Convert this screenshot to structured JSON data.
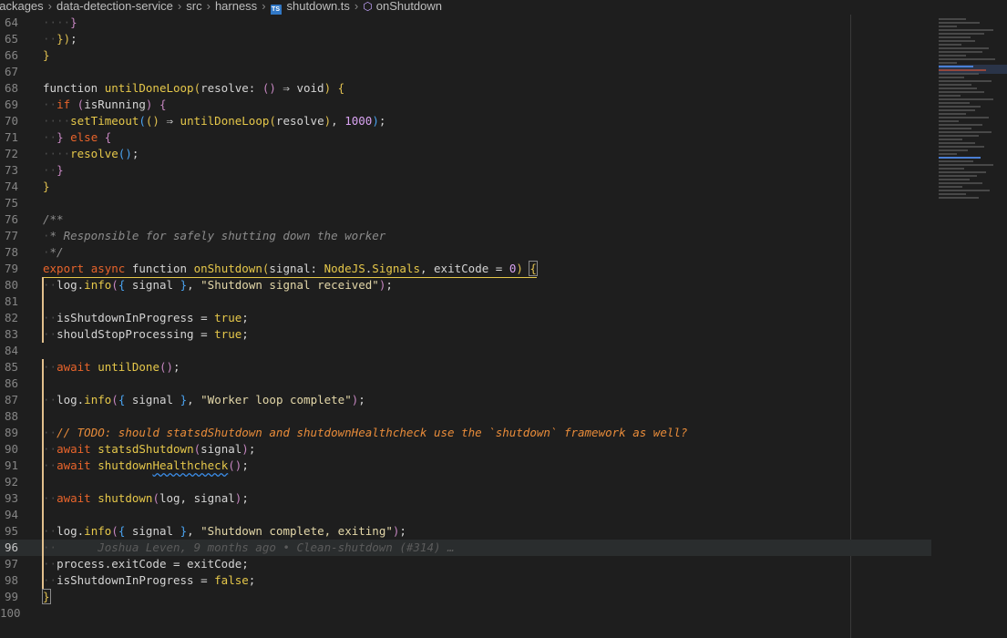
{
  "breadcrumb": {
    "segments": [
      "packages",
      "data-detection-service",
      "src",
      "harness",
      "shutdown.ts",
      "onShutdown"
    ],
    "file_icon": "TS"
  },
  "editor": {
    "line_numbers": [
      "64",
      "65",
      "66",
      "67",
      "68",
      "69",
      "70",
      "71",
      "72",
      "73",
      "74",
      "75",
      "76",
      "77",
      "78",
      "79",
      "80",
      "81",
      "82",
      "83",
      "84",
      "85",
      "86",
      "87",
      "88",
      "89",
      "90",
      "91",
      "92",
      "93",
      "94",
      "95",
      "96",
      "97",
      "98",
      "99",
      "100"
    ],
    "current_line": "96",
    "blame_text": "Joshua Leven, 9 months ago • Clean-shutdown (#314) …",
    "comment_responsible": "* Responsible for safely shutting down the worker",
    "comment_todo": "// TODO: should statsdShutdown and shutdownHealthcheck use the `shutdown` framework as well?",
    "str_signal_received": "\"Shutdown signal received\"",
    "str_worker_loop": "\"Worker loop complete\"",
    "str_shutdown_complete": "\"Shutdown complete, exiting\""
  },
  "colors": {
    "background": "#1e1e1e",
    "keyword": "#e8642b",
    "function": "#e6c84a",
    "string": "#e3d7a8",
    "number": "#d9a3f2",
    "comment": "#8c8c8c",
    "git_modified": "#e2c08d"
  }
}
